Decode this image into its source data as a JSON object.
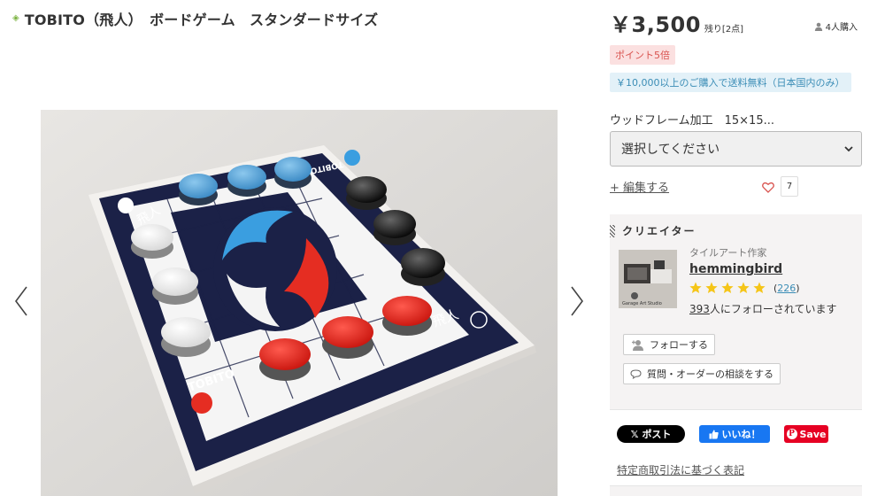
{
  "product": {
    "title": "TOBITO（飛人）　ボードゲーム　スタンダードサイズ",
    "price": "￥3,500",
    "stock": "残り[2点]",
    "buyers": "4人購入",
    "point_badge": "ポイント5倍",
    "shipping_badge": "￥10,000以上のご購入で送料無料（日本国内のみ）"
  },
  "option": {
    "label": "ウッドフレーム加工　15×15...",
    "select_value": "選択してください"
  },
  "actions": {
    "edit_label": "+ 編集する",
    "favorite_count": "7"
  },
  "board_image": {
    "brand_text": "TOBITO",
    "kanji": "飛人"
  },
  "creator": {
    "heading": "クリエイター",
    "role": "タイルアート作家",
    "name": "hemmingbird",
    "rating_stars": 5,
    "review_count": "226",
    "followers_count": "393",
    "followers_suffix": "人にフォローされています",
    "thumb_caption": "Garage Art Studio",
    "follow_label": "フォローする",
    "inquiry_label": "質問・オーダーの相談をする"
  },
  "share": {
    "x_label": "ポスト",
    "fb_label": "いいね！",
    "pin_label": "Save"
  },
  "law_link": "特定商取引法に基づく表記",
  "colors": {
    "accent_red": "#d9534f",
    "point_bg": "#fbe0e0",
    "shipping_blue": "#3b8db6",
    "shipping_bg": "#e3f1f8",
    "star_yellow": "#f5c518",
    "facebook": "#1877f2",
    "pinterest": "#e60023"
  },
  "icons": {
    "title_marker": "diamond-icon",
    "buyers": "user-icon",
    "favorite": "heart-icon",
    "follow": "add-user-icon",
    "inquiry": "speech-bubble-icon",
    "prev": "chevron-left-icon",
    "next": "chevron-right-icon",
    "select": "chevron-down-icon"
  }
}
